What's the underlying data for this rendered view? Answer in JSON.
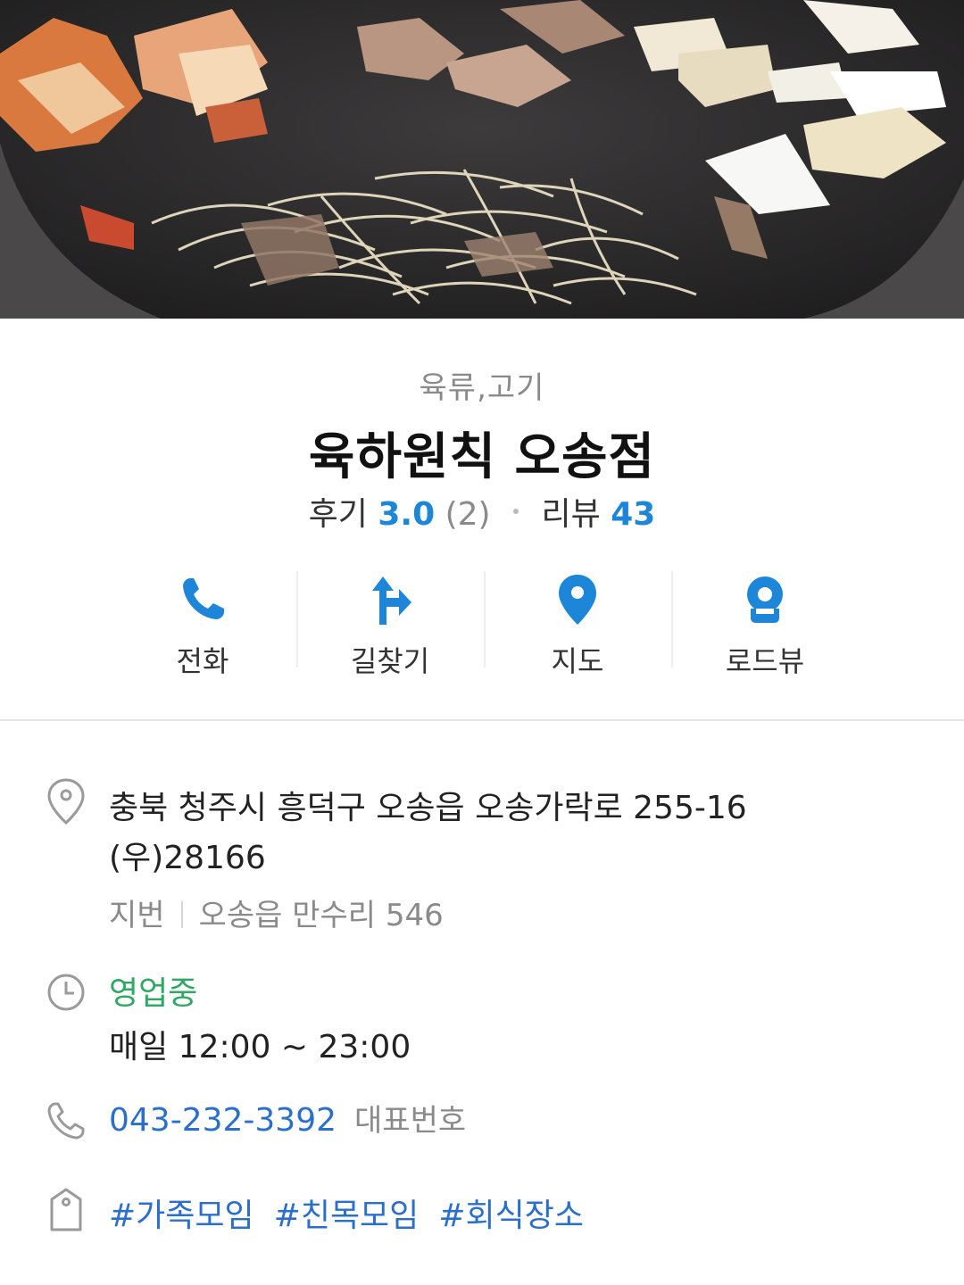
{
  "place": {
    "category": "육류,고기",
    "name": "육하원칙 오송점",
    "review_label": "후기",
    "review_score": "3.0",
    "review_count": "(2)",
    "blog_label": "리뷰",
    "blog_count": "43"
  },
  "actions": [
    {
      "label": "전화",
      "icon": "phone-icon"
    },
    {
      "label": "길찾기",
      "icon": "directions-icon"
    },
    {
      "label": "지도",
      "icon": "map-pin-icon"
    },
    {
      "label": "로드뷰",
      "icon": "roadview-icon"
    }
  ],
  "info": {
    "address_line1": "충북 청주시 흥덕구 오송읍 오송가락로 255-16",
    "address_line2": "(우)28166",
    "jibun_label": "지번",
    "jibun_value": "오송읍 만수리 546",
    "hours_status": "영업중",
    "hours_text": "매일 12:00 ~ 23:00",
    "phone": "043-232-3392",
    "phone_note": "대표번호",
    "tags": [
      "#가족모임",
      "#친목모임",
      "#회식장소"
    ]
  },
  "colors": {
    "accent_blue": "#1e86d9",
    "link_blue": "#2a6fcc",
    "open_green": "#2fa862"
  }
}
